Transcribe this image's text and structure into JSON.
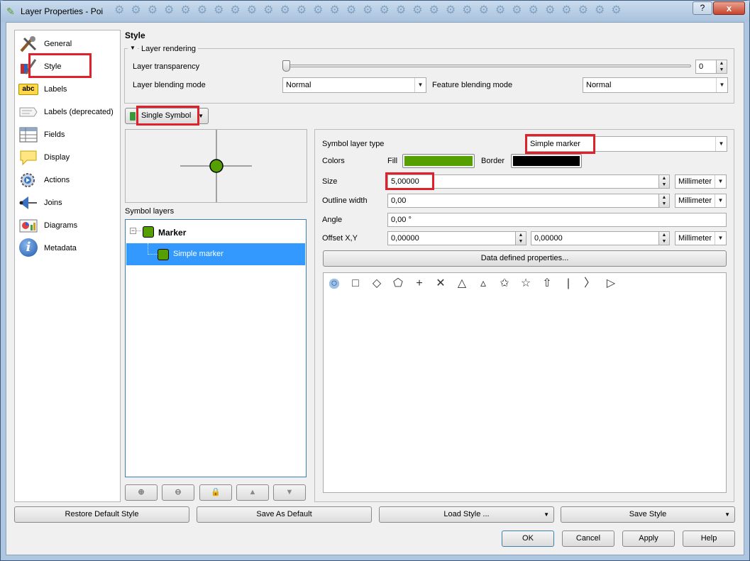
{
  "window": {
    "title": "Layer Properties - Poi",
    "help": "?",
    "close": "x"
  },
  "sidebar": {
    "items": [
      {
        "label": "General",
        "icon": "tools-icon"
      },
      {
        "label": "Style",
        "icon": "style-icon"
      },
      {
        "label": "Labels",
        "icon": "abc-label-icon",
        "icon_text": "abc"
      },
      {
        "label": "Labels (deprecated)",
        "icon": "label-deprecated-icon"
      },
      {
        "label": "Fields",
        "icon": "table-icon"
      },
      {
        "label": "Display",
        "icon": "speech-bubble-icon"
      },
      {
        "label": "Actions",
        "icon": "gear-icon"
      },
      {
        "label": "Joins",
        "icon": "join-icon"
      },
      {
        "label": "Diagrams",
        "icon": "diagram-icon"
      },
      {
        "label": "Metadata",
        "icon": "info-icon",
        "icon_text": "i"
      }
    ]
  },
  "style": {
    "heading": "Style",
    "layer_rendering": "Layer rendering",
    "transparency_label": "Layer transparency",
    "transparency_value": "0",
    "transparency_level": 0,
    "blending_label": "Layer blending mode",
    "blending_value": "Normal",
    "feature_blending_label": "Feature blending mode",
    "feature_blending_value": "Normal",
    "renderer": "Single Symbol",
    "symbol_layers_label": "Symbol layers",
    "tree": {
      "root": "Marker",
      "child": "Simple marker"
    },
    "symbol_layer_type_label": "Symbol layer type",
    "symbol_layer_type": "Simple marker",
    "colors_label": "Colors",
    "fill_label": "Fill",
    "fill_color": "#55a000",
    "border_label": "Border",
    "border_color": "#000000",
    "size_label": "Size",
    "size_value": "5,00000",
    "size_unit": "Millimeter",
    "outline_label": "Outline width",
    "outline_value": "0,00",
    "outline_unit": "Millimeter",
    "angle_label": "Angle",
    "angle_value": "0,00 °",
    "offset_label": "Offset X,Y",
    "offset_x": "0,00000",
    "offset_y": "0,00000",
    "offset_unit": "Millimeter",
    "data_defined": "Data defined properties...",
    "shapes": [
      "circle-icon",
      "square-icon",
      "diamond-icon",
      "pentagon-icon",
      "cross-icon",
      "x-icon",
      "triangle-icon",
      "equilateral-triangle-icon",
      "star-icon",
      "regular-star-icon",
      "arrow-icon",
      "line-icon",
      "arrowhead-icon",
      "filled-arrowhead-icon"
    ],
    "shape_glyphs": [
      "○",
      "□",
      "◇",
      "⬠",
      "+",
      "✕",
      "△",
      "▵",
      "✩",
      "☆",
      "⇧",
      "|",
      "〉",
      "▷"
    ]
  },
  "footer": {
    "restore": "Restore Default Style",
    "save_default": "Save As Default",
    "load": "Load Style ...",
    "save_style": "Save Style",
    "ok": "OK",
    "cancel": "Cancel",
    "apply": "Apply",
    "help": "Help"
  },
  "colors": {
    "accent": "#3399ff",
    "highlight_box": "#e0202a",
    "marker": "#55a000"
  }
}
